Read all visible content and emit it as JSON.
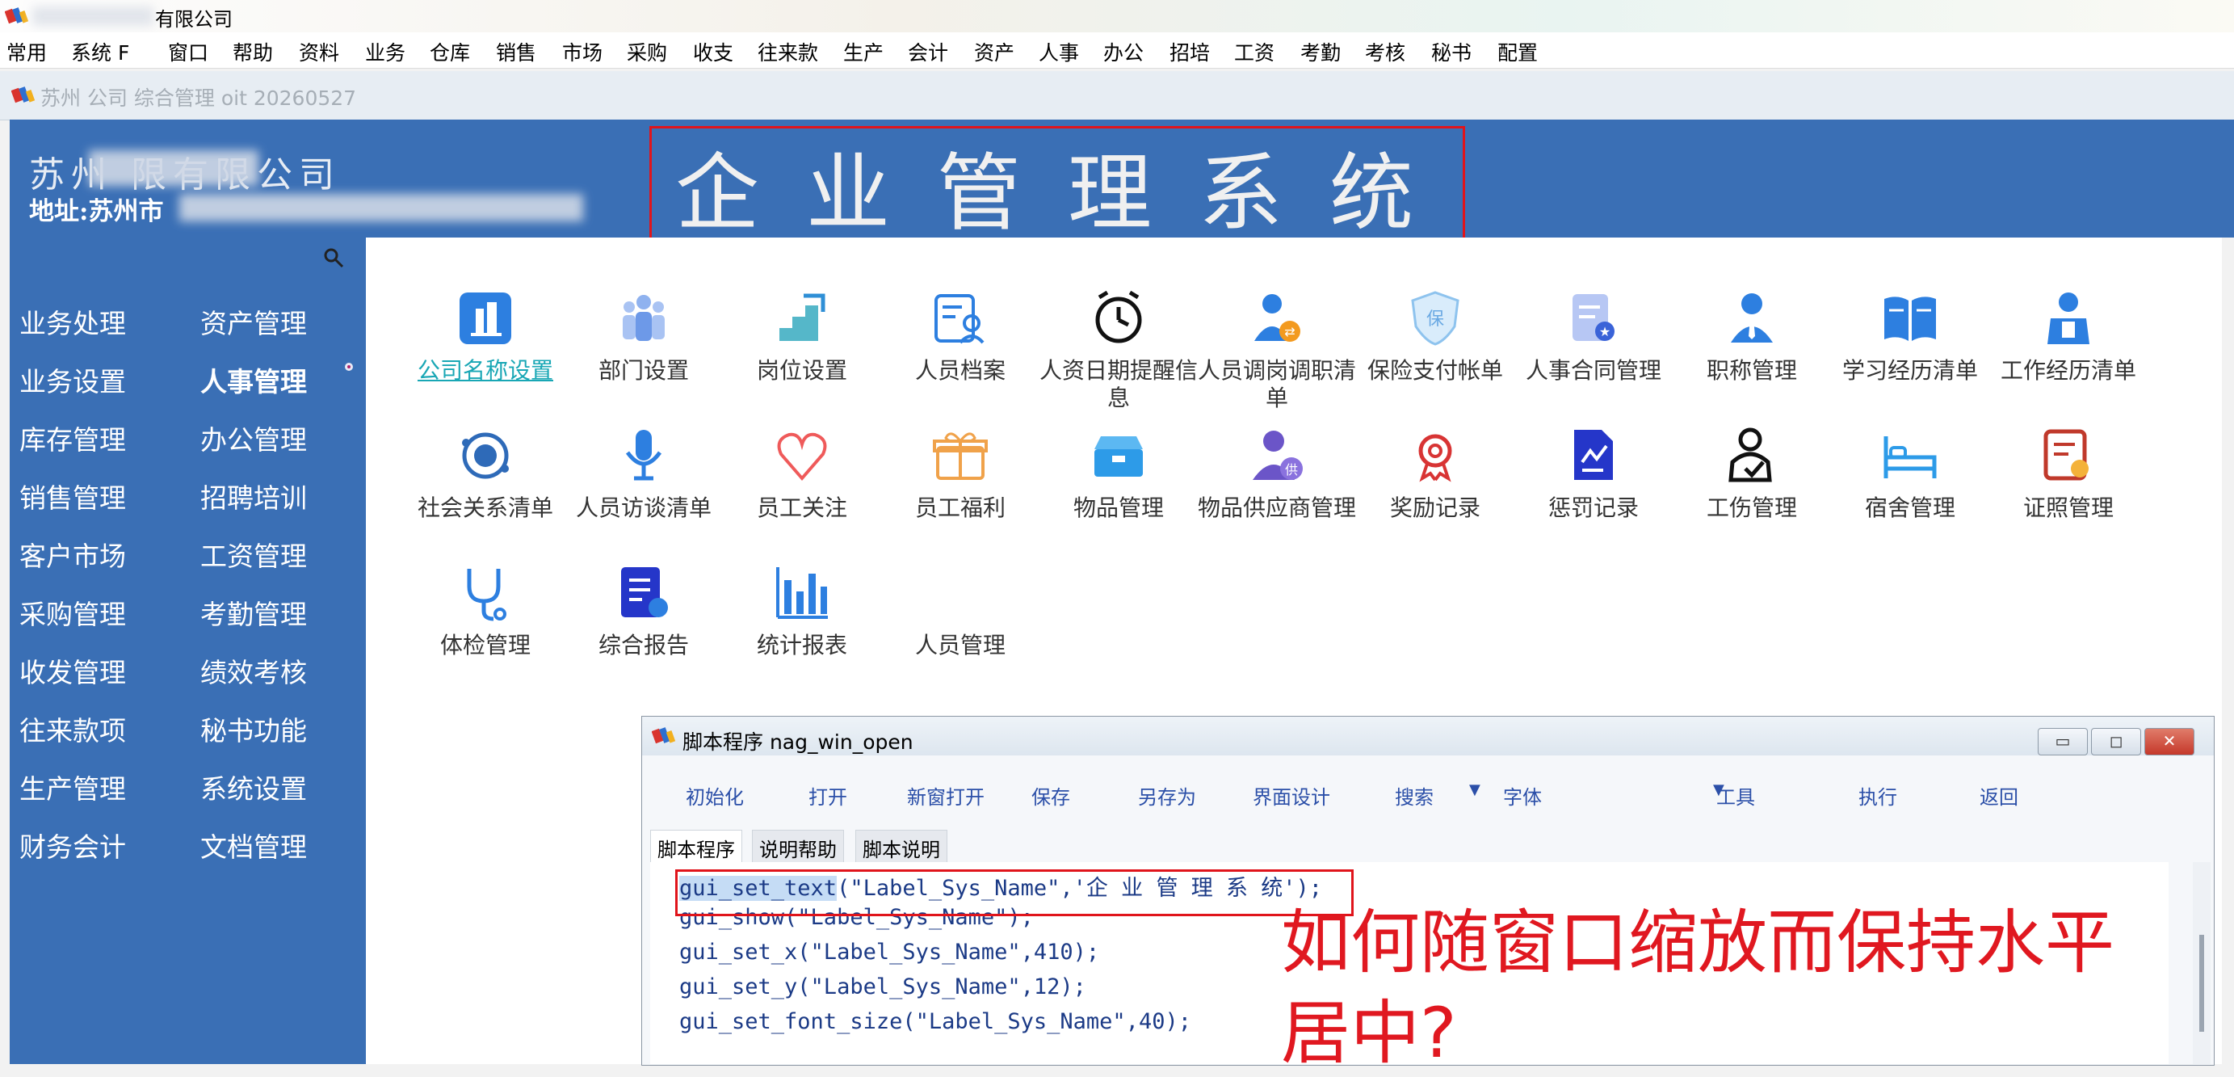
{
  "title_bar": {
    "text": "有限公司"
  },
  "menu": [
    "常用",
    "系统 F",
    "窗口",
    "帮助",
    "资料",
    "业务",
    "仓库",
    "销售",
    "市场",
    "采购",
    "收支",
    "往来款",
    "生产",
    "会计",
    "资产",
    "人事",
    "办公",
    "招培",
    "工资",
    "考勤",
    "考核",
    "秘书",
    "配置"
  ],
  "subwindow_title": "苏州 公司 综合管理 oit 20260527",
  "header": {
    "company": "苏州 限有限公司",
    "address": "地址:苏州市",
    "system_title": "企业管理系统"
  },
  "sidebar": {
    "col1": [
      "业务处理",
      "业务设置",
      "库存管理",
      "销售管理",
      "客户市场",
      "采购管理",
      "收发管理",
      "往来款项",
      "生产管理",
      "财务会计"
    ],
    "col2": [
      "资产管理",
      "人事管理",
      "办公管理",
      "招聘培训",
      "工资管理",
      "考勤管理",
      "绩效考核",
      "秘书功能",
      "系统设置",
      "文档管理"
    ]
  },
  "modules": [
    {
      "label": "公司名称设置",
      "icon": "building-icon",
      "link": true
    },
    {
      "label": "部门设置",
      "icon": "people-group-icon"
    },
    {
      "label": "岗位设置",
      "icon": "stairs-icon"
    },
    {
      "label": "人员档案",
      "icon": "person-file-icon"
    },
    {
      "label": "人资日期提醒信息",
      "icon": "alarm-clock-icon"
    },
    {
      "label": "人员调岗调职清单",
      "icon": "person-transfer-icon"
    },
    {
      "label": "保险支付帐单",
      "icon": "shield-icon"
    },
    {
      "label": "人事合同管理",
      "icon": "contract-icon"
    },
    {
      "label": "职称管理",
      "icon": "person-tie-icon"
    },
    {
      "label": "学习经历清单",
      "icon": "book-icon"
    },
    {
      "label": "工作经历清单",
      "icon": "worker-icon"
    },
    {
      "label": "社会关系清单",
      "icon": "network-icon"
    },
    {
      "label": "人员访谈清单",
      "icon": "microphone-icon"
    },
    {
      "label": "员工关注",
      "icon": "heart-icon"
    },
    {
      "label": "员工福利",
      "icon": "gift-icon"
    },
    {
      "label": "物品管理",
      "icon": "box-icon"
    },
    {
      "label": "物品供应商管理",
      "icon": "supplier-icon"
    },
    {
      "label": "奖励记录",
      "icon": "award-icon"
    },
    {
      "label": "惩罚记录",
      "icon": "penalty-doc-icon"
    },
    {
      "label": "工伤管理",
      "icon": "injury-icon"
    },
    {
      "label": "宿舍管理",
      "icon": "bed-icon"
    },
    {
      "label": "证照管理",
      "icon": "certificate-icon"
    },
    {
      "label": "体检管理",
      "icon": "stethoscope-icon"
    },
    {
      "label": "综合报告",
      "icon": "report-icon"
    },
    {
      "label": "统计报表",
      "icon": "bar-chart-icon"
    },
    {
      "label": "人员管理",
      "icon": "none"
    }
  ],
  "dialog": {
    "title": "脚本程序  nag_win_open",
    "toolbar": [
      "初始化",
      "打开",
      "新窗打开",
      "保存",
      "另存为",
      "界面设计",
      "搜索",
      "字体",
      "工具",
      "执行",
      "返回"
    ],
    "tabs": [
      "脚本程序",
      "说明帮助",
      "脚本说明"
    ],
    "code": [
      "gui_set_text(\"Label_Sys_Name\",'企 业 管 理 系 统');",
      "gui_show(\"Label_Sys_Name\");",
      "gui_set_x(\"Label_Sys_Name\",410);",
      "gui_set_y(\"Label_Sys_Name\",12);",
      "gui_set_font_size(\"Label_Sys_Name\",40);"
    ],
    "highlighted_token": "gui_set_text"
  },
  "annotation": {
    "line1": "如何随窗口缩放而保持水平",
    "line2": "居中?"
  },
  "colors": {
    "accent_blue": "#3a6fb5",
    "annotation_red": "#e01820",
    "link_teal": "#19a7b5"
  }
}
